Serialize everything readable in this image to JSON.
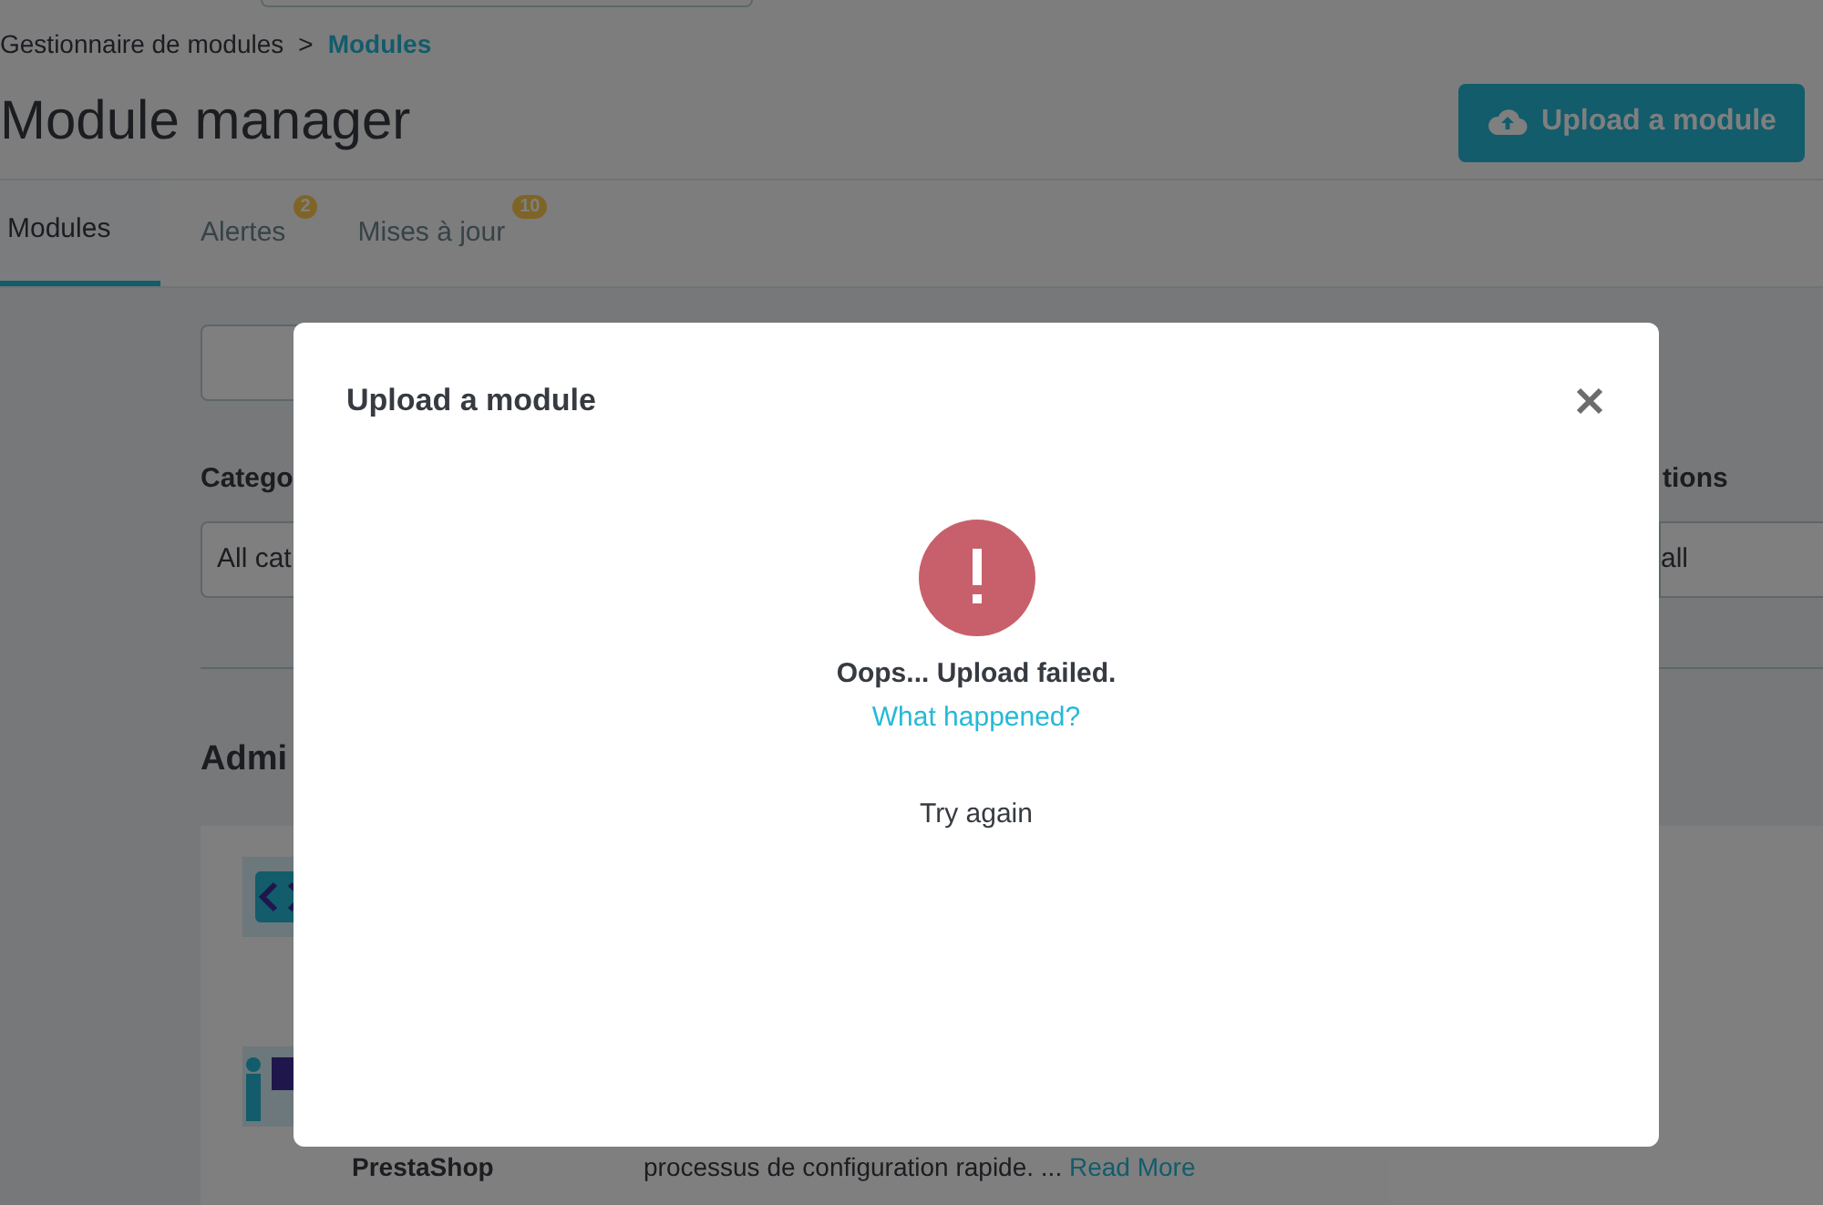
{
  "breadcrumb": [
    {
      "label": "Gestionnaire de modules",
      "current": false
    },
    {
      "label": "Modules",
      "current": true
    }
  ],
  "separator": ">",
  "title": "Module manager",
  "upload_button": "Upload a module",
  "tabs": [
    {
      "label": "Modules",
      "selected": true
    },
    {
      "label": "Alertes",
      "selected": false,
      "badge": "2"
    },
    {
      "label": "Mises à jour",
      "selected": false,
      "badge": "10"
    }
  ],
  "filters": {
    "category_label": "Catego",
    "category_value": "All cat",
    "actions_label": "tions",
    "actions_value": "all"
  },
  "section_title": "Admi",
  "module_row": {
    "author": "PrestaShop",
    "description": "processus de configuration rapide. ...",
    "read_more": "Read More"
  },
  "modal": {
    "title": "Upload a module",
    "message": "Oops... Upload failed.",
    "link": "What happened?",
    "retry": "Try again"
  }
}
